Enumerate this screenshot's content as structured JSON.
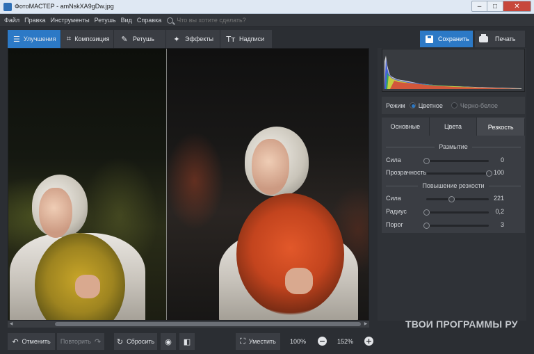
{
  "window": {
    "title": "ФотоМАСТЕР - amNskXA9gDw.jpg",
    "min": "–",
    "max": "□",
    "close": "✕"
  },
  "menu": {
    "items": [
      "Файл",
      "Правка",
      "Инструменты",
      "Ретушь",
      "Вид",
      "Справка"
    ],
    "search_placeholder": "Что вы хотите сделать?"
  },
  "tabs": [
    {
      "label": "Улучшения",
      "icon": "sliders-icon"
    },
    {
      "label": "Композиция",
      "icon": "crop-icon"
    },
    {
      "label": "Ретушь",
      "icon": "brush-icon"
    },
    {
      "label": "Эффекты",
      "icon": "magic-wand-icon"
    },
    {
      "label": "Надписи",
      "icon": "text-icon"
    }
  ],
  "actions": {
    "save": "Сохранить",
    "print": "Печать"
  },
  "mode": {
    "label": "Режим",
    "color": "Цветное",
    "bw": "Черно-белое",
    "selected": "color"
  },
  "subtabs": [
    "Основные",
    "Цвета",
    "Резкость"
  ],
  "active_subtab": "Резкость",
  "sections": {
    "blur": {
      "title": "Размытие",
      "sliders": [
        {
          "label": "Сила",
          "value": "0",
          "level": 0.0
        },
        {
          "label": "Прозрачность",
          "value": "100",
          "level": 1.0
        }
      ]
    },
    "sharpen": {
      "title": "Повышение резкости",
      "sliders": [
        {
          "label": "Сила",
          "value": "221",
          "level": 0.4
        },
        {
          "label": "Радиус",
          "value": "0,2",
          "level": 0.0
        },
        {
          "label": "Порог",
          "value": "3",
          "level": 0.0
        }
      ]
    }
  },
  "bottom": {
    "undo": "Отменить",
    "redo": "Повторить",
    "reset": "Сбросить",
    "fit": "Уместить",
    "zoom_fit": "100%",
    "zoom_current": "152%"
  },
  "watermark": "ТВОИ ПРОГРАММЫ РУ",
  "colors": {
    "accent": "#2c79c6",
    "background": "#2b2e33",
    "panel": "#3a3d43"
  }
}
